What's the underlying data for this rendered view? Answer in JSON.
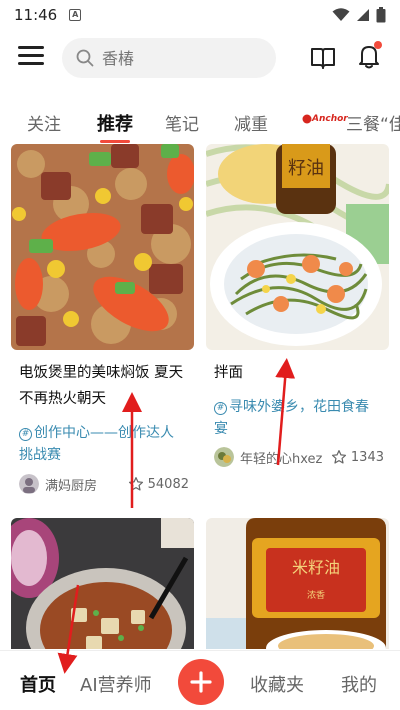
{
  "status_bar": {
    "time": "11:46",
    "badge": "A"
  },
  "header": {
    "search_placeholder": "香椿"
  },
  "tabs": [
    {
      "label": "关注"
    },
    {
      "label": "推荐",
      "active": true
    },
    {
      "label": "笔记"
    },
    {
      "label": "减重"
    },
    {
      "label": "三餐“佳"
    }
  ],
  "anchor_logo_text": "Anchor",
  "cards": [
    {
      "title": "电饭煲里的美味焖饭 夏天不再热火朝天",
      "topic": "创作中心——创作达人挑战赛",
      "author": "满妈厨房",
      "likes": "54082"
    },
    {
      "title": "拌面",
      "topic": "寻味外婆乡，花田食春宴",
      "author": "年轻的心hxez",
      "likes": "1343"
    }
  ],
  "bottom_nav": {
    "home": "首页",
    "ai": "AI营养师",
    "favorites": "收藏夹",
    "me": "我的"
  },
  "colors": {
    "accent": "#f24a3b",
    "topic": "#3a8bb0",
    "arrow": "#e11d1d"
  }
}
